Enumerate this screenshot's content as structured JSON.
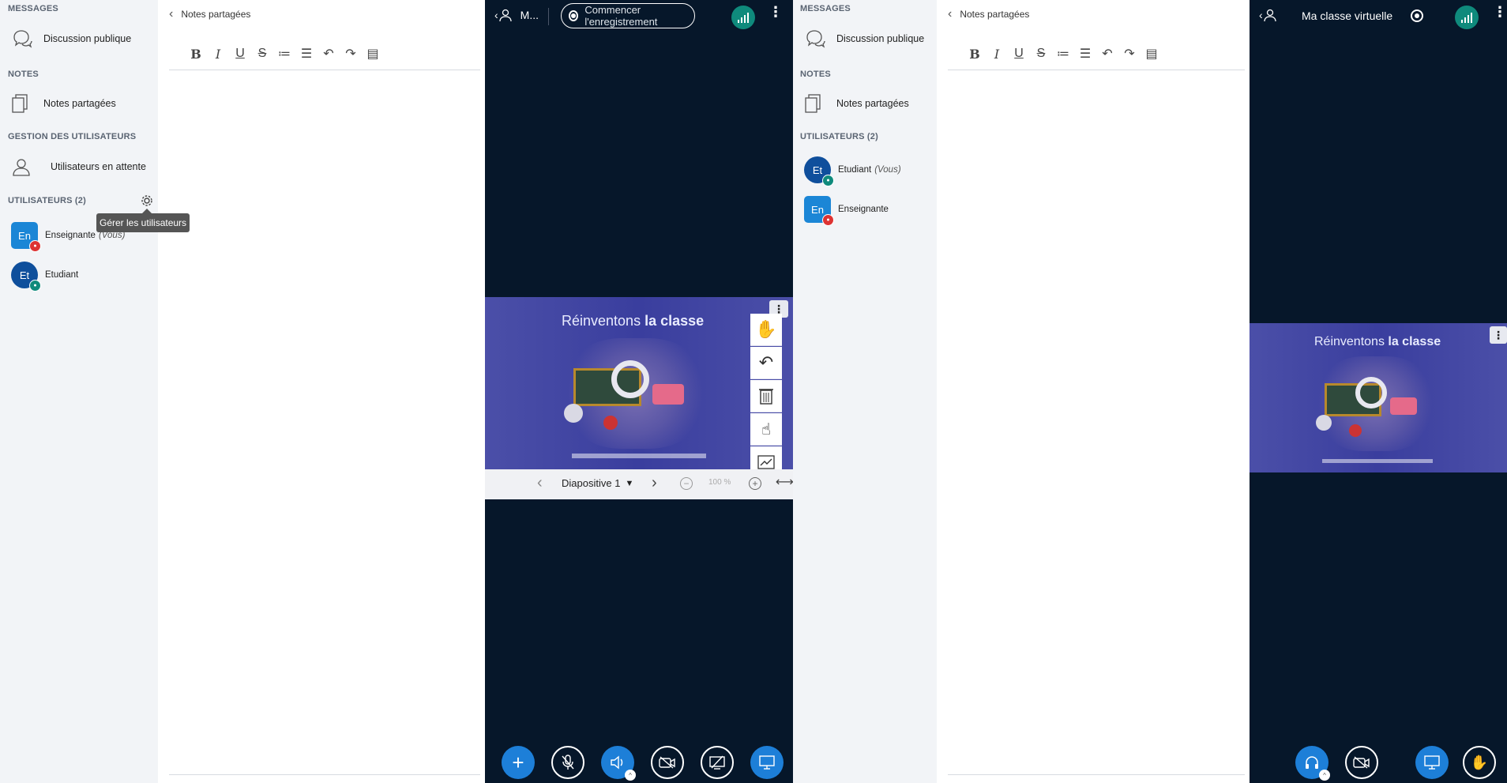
{
  "left_panel": {
    "sidebar": {
      "messages_title": "MESSAGES",
      "public_chat": "Discussion publique",
      "notes_title": "NOTES",
      "shared_notes": "Notes partagées",
      "user_mgmt_title": "GESTION DES UTILISATEURS",
      "waiting_users": "Utilisateurs en attente",
      "users_title": "UTILISATEURS (2)",
      "tooltip": "Gérer les utilisateurs",
      "users": [
        {
          "initials": "En",
          "name": "Enseignante",
          "suffix": "(Vous)",
          "color": "#1b86d6"
        },
        {
          "initials": "Et",
          "name": "Etudiant",
          "suffix": "",
          "color": "#0f4f9c"
        }
      ]
    },
    "notes": {
      "title": "Notes partagées"
    },
    "meeting": {
      "title": "M...",
      "record_label": "Commencer l'enregistrement",
      "slide": {
        "title_light": "Réinventons ",
        "title_bold": "la classe"
      },
      "slide_nav": {
        "label": "Diapositive 1",
        "zoom": "100 %"
      }
    }
  },
  "right_panel": {
    "sidebar": {
      "messages_title": "MESSAGES",
      "public_chat": "Discussion publique",
      "notes_title": "NOTES",
      "shared_notes": "Notes partagées",
      "users_title": "UTILISATEURS (2)",
      "users": [
        {
          "initials": "Et",
          "name": "Etudiant",
          "suffix": "(Vous)",
          "color": "#0f4f9c"
        },
        {
          "initials": "En",
          "name": "Enseignante",
          "suffix": "",
          "color": "#1b86d6"
        }
      ]
    },
    "notes": {
      "title": "Notes partagées"
    },
    "meeting": {
      "title": "Ma classe virtuelle",
      "slide": {
        "title_light": "Réinventons ",
        "title_bold": "la classe"
      }
    }
  },
  "colors": {
    "dark_bg": "#06172a",
    "accent": "#1d7fd8",
    "signal": "#0f8a7c"
  }
}
